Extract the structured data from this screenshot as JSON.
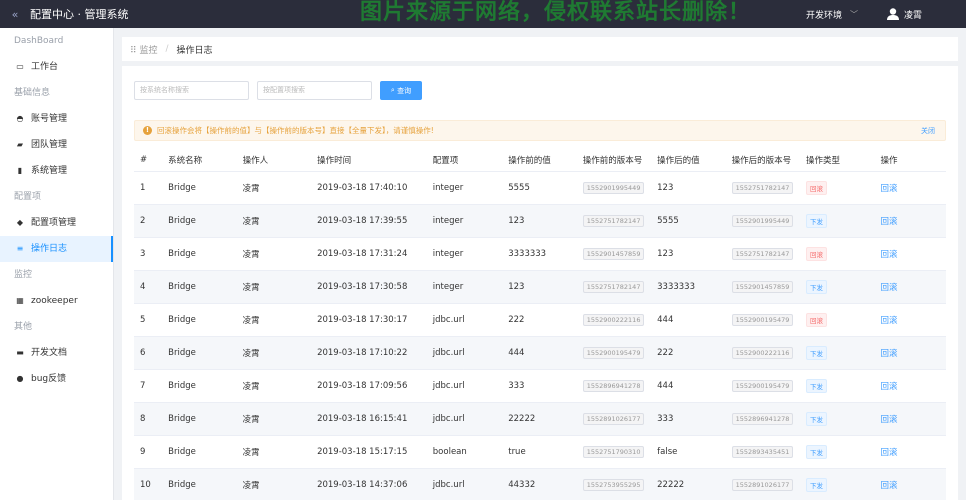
{
  "header": {
    "app_title": "配置中心 · 管理系统",
    "watermark": "图片来源于网络，侵权联系站长删除！",
    "env_label": "开发环境",
    "user_name": "凌霄"
  },
  "sidebar": {
    "items": [
      {
        "type": "group",
        "label": "DashBoard"
      },
      {
        "type": "item",
        "label": "工作台",
        "icon": "desktop-icon",
        "glyph": "▭"
      },
      {
        "type": "group",
        "label": "基础信息"
      },
      {
        "type": "item",
        "label": "账号管理",
        "icon": "account-icon",
        "glyph": "◓"
      },
      {
        "type": "item",
        "label": "团队管理",
        "icon": "team-icon",
        "glyph": "▰"
      },
      {
        "type": "item",
        "label": "系统管理",
        "icon": "system-icon",
        "glyph": "▮"
      },
      {
        "type": "group",
        "label": "配置项"
      },
      {
        "type": "item",
        "label": "配置项管理",
        "icon": "config-icon",
        "glyph": "◆"
      },
      {
        "type": "item",
        "label": "操作日志",
        "icon": "log-icon",
        "glyph": "≡",
        "active": true
      },
      {
        "type": "group",
        "label": "监控"
      },
      {
        "type": "item",
        "label": "zookeeper",
        "icon": "zookeeper-icon",
        "glyph": "▦"
      },
      {
        "type": "group",
        "label": "其他"
      },
      {
        "type": "item",
        "label": "开发文档",
        "icon": "docs-icon",
        "glyph": "▬"
      },
      {
        "type": "item",
        "label": "bug反馈",
        "icon": "bug-icon",
        "glyph": "●"
      }
    ]
  },
  "breadcrumb": {
    "home": "监控",
    "current": "操作日志"
  },
  "search": {
    "system_placeholder": "按系统名称搜索",
    "config_placeholder": "按配置项搜索",
    "query_label": "查询"
  },
  "alert": {
    "text": "回滚操作会将【操作前的值】与【操作前的版本号】直接【全量下发】，请谨慎操作!",
    "close_label": "关闭"
  },
  "table": {
    "headers": [
      "#",
      "系统名称",
      "操作人",
      "操作时间",
      "配置项",
      "操作前的值",
      "操作前的版本号",
      "操作后的值",
      "操作后的版本号",
      "操作类型",
      "操作"
    ],
    "rows": [
      {
        "no": "1",
        "system": "Bridge",
        "operator": "凌霄",
        "time": "2019-03-18 17:40:10",
        "key": "integer",
        "before": "5555",
        "before_ver": "1552901995449",
        "after": "123",
        "after_ver": "1552751782147",
        "type": "回滚",
        "type_color": "red",
        "action": "回滚"
      },
      {
        "no": "2",
        "system": "Bridge",
        "operator": "凌霄",
        "time": "2019-03-18 17:39:55",
        "key": "integer",
        "before": "123",
        "before_ver": "1552751782147",
        "after": "5555",
        "after_ver": "1552901995449",
        "type": "下发",
        "type_color": "blue",
        "action": "回滚"
      },
      {
        "no": "3",
        "system": "Bridge",
        "operator": "凌霄",
        "time": "2019-03-18 17:31:24",
        "key": "integer",
        "before": "3333333",
        "before_ver": "1552901457859",
        "after": "123",
        "after_ver": "1552751782147",
        "type": "回滚",
        "type_color": "red",
        "action": "回滚"
      },
      {
        "no": "4",
        "system": "Bridge",
        "operator": "凌霄",
        "time": "2019-03-18 17:30:58",
        "key": "integer",
        "before": "123",
        "before_ver": "1552751782147",
        "after": "3333333",
        "after_ver": "1552901457859",
        "type": "下发",
        "type_color": "blue",
        "action": "回滚"
      },
      {
        "no": "5",
        "system": "Bridge",
        "operator": "凌霄",
        "time": "2019-03-18 17:30:17",
        "key": "jdbc.url",
        "before": "222",
        "before_ver": "1552900222116",
        "after": "444",
        "after_ver": "1552900195479",
        "type": "回滚",
        "type_color": "red",
        "action": "回滚"
      },
      {
        "no": "6",
        "system": "Bridge",
        "operator": "凌霄",
        "time": "2019-03-18 17:10:22",
        "key": "jdbc.url",
        "before": "444",
        "before_ver": "1552900195479",
        "after": "222",
        "after_ver": "1552900222116",
        "type": "下发",
        "type_color": "blue",
        "action": "回滚"
      },
      {
        "no": "7",
        "system": "Bridge",
        "operator": "凌霄",
        "time": "2019-03-18 17:09:56",
        "key": "jdbc.url",
        "before": "333",
        "before_ver": "1552896941278",
        "after": "444",
        "after_ver": "1552900195479",
        "type": "下发",
        "type_color": "blue",
        "action": "回滚"
      },
      {
        "no": "8",
        "system": "Bridge",
        "operator": "凌霄",
        "time": "2019-03-18 16:15:41",
        "key": "jdbc.url",
        "before": "22222",
        "before_ver": "1552891026177",
        "after": "333",
        "after_ver": "1552896941278",
        "type": "下发",
        "type_color": "blue",
        "action": "回滚"
      },
      {
        "no": "9",
        "system": "Bridge",
        "operator": "凌霄",
        "time": "2019-03-18 15:17:15",
        "key": "boolean",
        "before": "true",
        "before_ver": "1552751790310",
        "after": "false",
        "after_ver": "1552893435451",
        "type": "下发",
        "type_color": "blue",
        "action": "回滚"
      },
      {
        "no": "10",
        "system": "Bridge",
        "operator": "凌霄",
        "time": "2019-03-18 14:37:06",
        "key": "jdbc.url",
        "before": "44332",
        "before_ver": "1552753955295",
        "after": "22222",
        "after_ver": "1552891026177",
        "type": "下发",
        "type_color": "blue",
        "action": "回滚"
      }
    ]
  }
}
